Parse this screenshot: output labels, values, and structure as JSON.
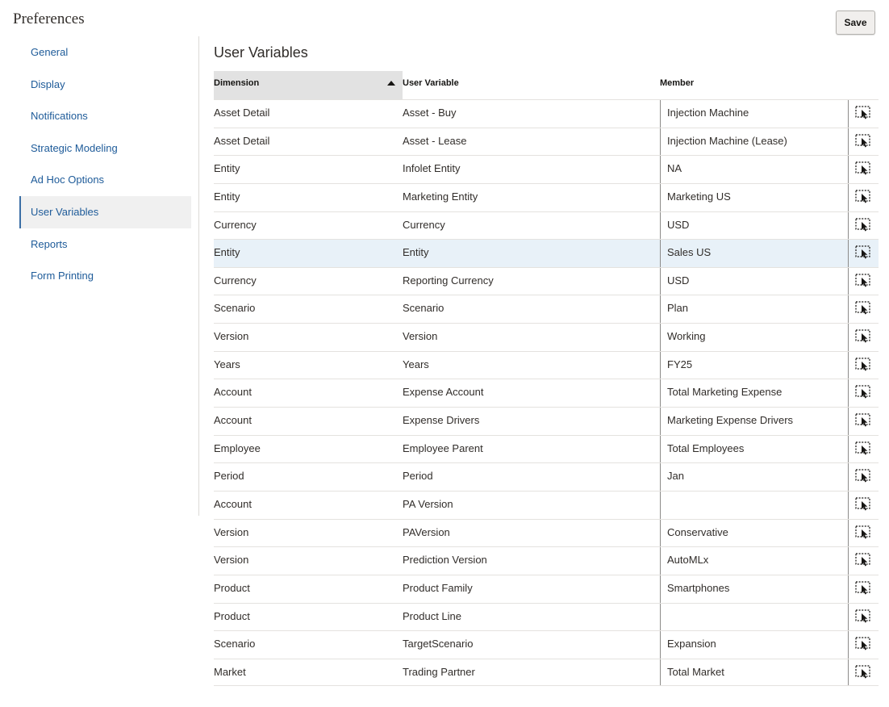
{
  "header": {
    "title": "Preferences",
    "save_label": "Save"
  },
  "sidebar": {
    "items": [
      {
        "label": "General"
      },
      {
        "label": "Display"
      },
      {
        "label": "Notifications"
      },
      {
        "label": "Strategic Modeling"
      },
      {
        "label": "Ad Hoc Options"
      },
      {
        "label": "User Variables",
        "active": true
      },
      {
        "label": "Reports"
      },
      {
        "label": "Form Printing"
      }
    ]
  },
  "main": {
    "title": "User Variables",
    "columns": {
      "dimension": "Dimension",
      "variable": "User Variable",
      "member": "Member"
    },
    "sort": {
      "column": "Dimension",
      "direction": "ascending"
    },
    "selected_row": 5,
    "rows": [
      {
        "dimension": "Asset Detail",
        "variable": "Asset - Buy",
        "member": "Injection Machine"
      },
      {
        "dimension": "Asset Detail",
        "variable": "Asset - Lease",
        "member": "Injection Machine (Lease)"
      },
      {
        "dimension": "Entity",
        "variable": "Infolet Entity",
        "member": "NA"
      },
      {
        "dimension": "Entity",
        "variable": "Marketing Entity",
        "member": "Marketing US"
      },
      {
        "dimension": "Currency",
        "variable": "Currency",
        "member": "USD"
      },
      {
        "dimension": "Entity",
        "variable": "Entity",
        "member": "Sales US"
      },
      {
        "dimension": "Currency",
        "variable": "Reporting Currency",
        "member": "USD"
      },
      {
        "dimension": "Scenario",
        "variable": "Scenario",
        "member": "Plan"
      },
      {
        "dimension": "Version",
        "variable": "Version",
        "member": "Working"
      },
      {
        "dimension": "Years",
        "variable": "Years",
        "member": "FY25"
      },
      {
        "dimension": "Account",
        "variable": "Expense Account",
        "member": "Total Marketing Expense"
      },
      {
        "dimension": "Account",
        "variable": "Expense Drivers",
        "member": "Marketing Expense Drivers"
      },
      {
        "dimension": "Employee",
        "variable": "Employee Parent",
        "member": "Total Employees"
      },
      {
        "dimension": "Period",
        "variable": "Period",
        "member": "Jan"
      },
      {
        "dimension": "Account",
        "variable": "PA Version",
        "member": ""
      },
      {
        "dimension": "Version",
        "variable": "PAVersion",
        "member": "Conservative"
      },
      {
        "dimension": "Version",
        "variable": "Prediction Version",
        "member": "AutoMLx"
      },
      {
        "dimension": "Product",
        "variable": "Product Family",
        "member": "Smartphones"
      },
      {
        "dimension": "Product",
        "variable": "Product Line",
        "member": ""
      },
      {
        "dimension": "Scenario",
        "variable": "TargetScenario",
        "member": "Expansion"
      },
      {
        "dimension": "Market",
        "variable": "Trading Partner",
        "member": "Total Market"
      }
    ],
    "picker_icon": "member-selector-icon"
  },
  "colors": {
    "link": "#1e5b99",
    "selected_row": "#e8f1f8",
    "header_sorted": "#e2e2e2"
  }
}
